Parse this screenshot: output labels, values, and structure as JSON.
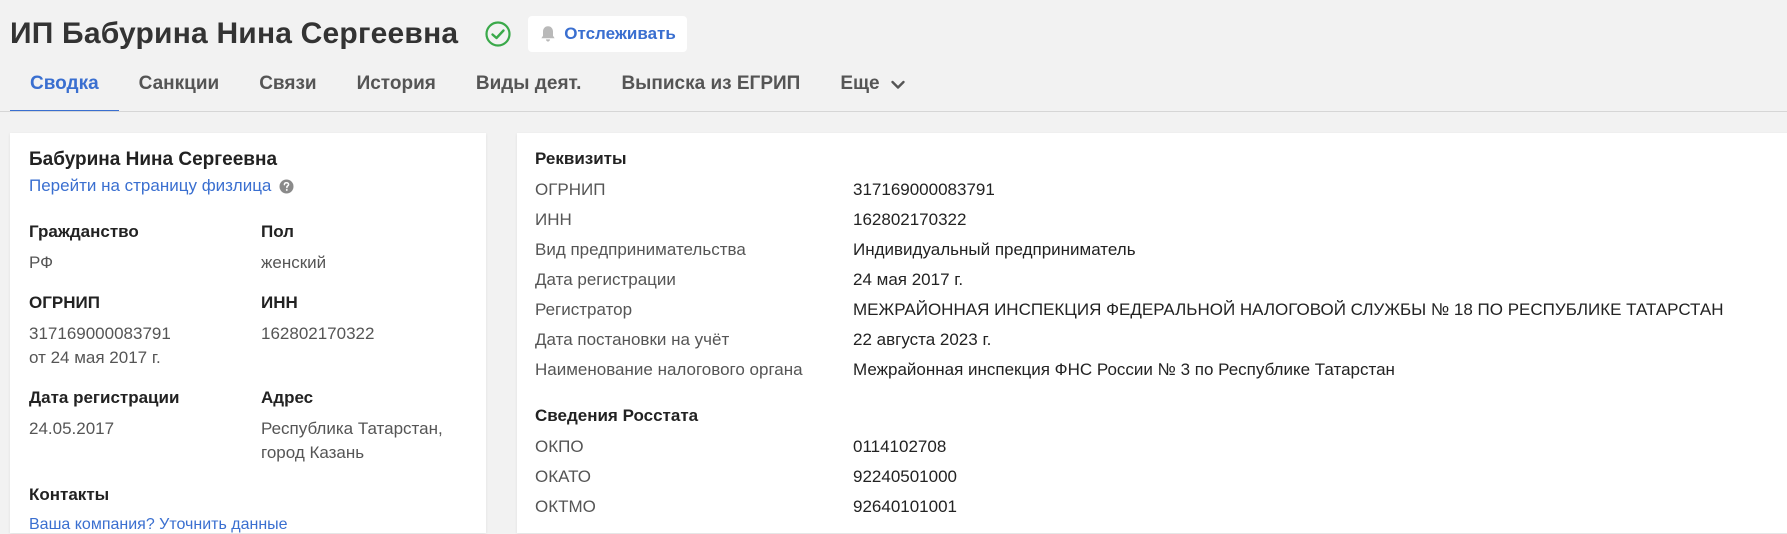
{
  "header": {
    "title": "ИП Бабурина Нина Сергеевна",
    "track_label": "Отслеживать",
    "icons": {
      "verified": "check-circle-icon",
      "bell": "bell-icon"
    },
    "colors": {
      "accent": "#3a6fd0",
      "verified": "#3aa94a"
    }
  },
  "tabs": [
    {
      "label": "Сводка",
      "active": true
    },
    {
      "label": "Санкции"
    },
    {
      "label": "Связи"
    },
    {
      "label": "История"
    },
    {
      "label": "Виды деят."
    },
    {
      "label": "Выписка из ЕГРИП"
    },
    {
      "label": "Еще"
    }
  ],
  "left_card": {
    "name": "Бабурина Нина Сергеевна",
    "person_link": "Перейти на страницу физлица",
    "citizenship_label": "Гражданство",
    "citizenship_value": "РФ",
    "gender_label": "Пол",
    "gender_value": "женский",
    "ogrnip_label": "ОГРНИП",
    "ogrnip_value": "317169000083791",
    "ogrnip_date": "от 24 мая 2017 г.",
    "inn_label": "ИНН",
    "inn_value": "162802170322",
    "reg_date_label": "Дата регистрации",
    "reg_date_value": "24.05.2017",
    "address_label": "Адрес",
    "address_line1": "Республика Татарстан,",
    "address_line2": "город Казань",
    "contacts_label": "Контакты",
    "contacts_link": "Ваша компания? Уточнить данные"
  },
  "right_card": {
    "requisites_title": "Реквизиты",
    "requisites": [
      {
        "label": "ОГРНИП",
        "value": "317169000083791"
      },
      {
        "label": "ИНН",
        "value": "162802170322"
      },
      {
        "label": "Вид предпринимательства",
        "value": "Индивидуальный предприниматель"
      },
      {
        "label": "Дата регистрации",
        "value": "24 мая 2017 г."
      },
      {
        "label": "Регистратор",
        "value": "МЕЖРАЙОННАЯ ИНСПЕКЦИЯ ФЕДЕРАЛЬНОЙ НАЛОГОВОЙ СЛУЖБЫ № 18 ПО РЕСПУБЛИКЕ ТАТАРСТАН"
      },
      {
        "label": "Дата постановки на учёт",
        "value": "22 августа 2023 г."
      },
      {
        "label": "Наименование налогового органа",
        "value": "Межрайонная инспекция ФНС России № 3 по Республике Татарстан"
      }
    ],
    "rosstat_title": "Сведения Росстата",
    "rosstat": [
      {
        "label": "ОКПО",
        "value": "0114102708"
      },
      {
        "label": "ОКАТО",
        "value": "92240501000"
      },
      {
        "label": "ОКТМО",
        "value": "92640101001"
      }
    ]
  }
}
